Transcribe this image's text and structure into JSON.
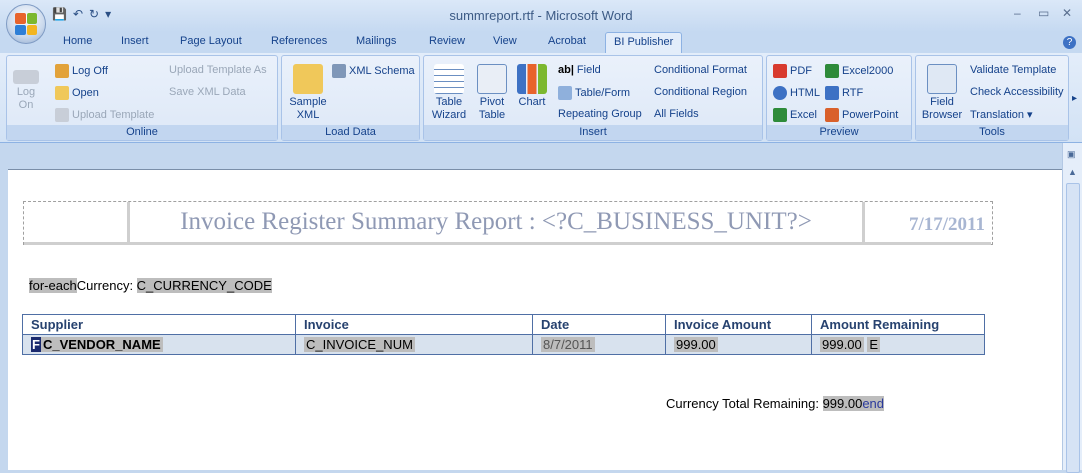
{
  "window": {
    "title": "summreport.rtf - Microsoft Word",
    "controls": [
      "–",
      "▭",
      "✕"
    ]
  },
  "tabs": [
    "Home",
    "Insert",
    "Page Layout",
    "References",
    "Mailings",
    "Review",
    "View",
    "Acrobat",
    "BI Publisher"
  ],
  "ribbon": {
    "online": {
      "label": "Online",
      "log_on": "Log\nOn",
      "log_on_l1": "Log",
      "log_on_l2": "On",
      "log_off": "Log Off",
      "open": "Open",
      "upload_template": "Upload Template",
      "upload_template_as": "Upload Template As",
      "save_xml_data": "Save XML Data"
    },
    "load_data": {
      "label": "Load Data",
      "sample_xml_l1": "Sample",
      "sample_xml_l2": "XML",
      "xml_schema": "XML Schema"
    },
    "insert": {
      "label": "Insert",
      "table_wizard_l1": "Table",
      "table_wizard_l2": "Wizard",
      "pivot_table_l1": "Pivot",
      "pivot_table_l2": "Table",
      "chart": "Chart",
      "field": "Field",
      "table_form": "Table/Form",
      "repeating_group": "Repeating Group",
      "conditional_format": "Conditional Format",
      "conditional_region": "Conditional Region",
      "all_fields": "All Fields"
    },
    "preview": {
      "label": "Preview",
      "pdf": "PDF",
      "html": "HTML",
      "excel": "Excel",
      "excel2000": "Excel2000",
      "rtf": "RTF",
      "powerpoint": "PowerPoint"
    },
    "tools": {
      "label": "Tools",
      "field_browser_l1": "Field",
      "field_browser_l2": "Browser",
      "validate_template": "Validate Template",
      "check_accessibility": "Check Accessibility",
      "translation": "Translation"
    }
  },
  "document": {
    "report_title": "Invoice Register Summary Report : <?C_BUSINESS_UNIT?>",
    "report_date": "7/17/2011",
    "for_each": "for-each",
    "currency_label": "Currency: ",
    "currency_code": "C_CURRENCY_CODE",
    "table": {
      "headers": [
        "Supplier",
        "Invoice",
        "Date",
        "Invoice Amount",
        "Amount Remaining"
      ],
      "row": {
        "supplier_prefix": "F",
        "supplier": "C_VENDOR_NAME",
        "invoice": "C_INVOICE_NUM",
        "date": "8/7/2011",
        "amount": "999.00",
        "remaining": "999.00",
        "remaining_suffix": "E"
      }
    },
    "total_label": "Currency Total Remaining: ",
    "total_value": "999.00",
    "end_tag": "end"
  }
}
